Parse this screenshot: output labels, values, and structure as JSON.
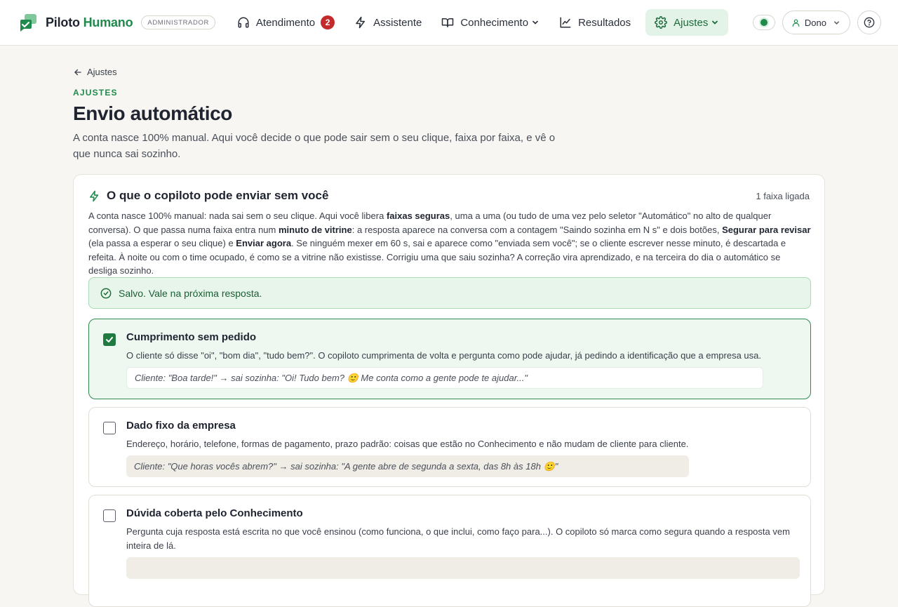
{
  "brand": {
    "name_a": "Piloto ",
    "name_b": "Humano",
    "role": "ADMINISTRADOR",
    "accent_color": "#1f8a4c"
  },
  "nav": {
    "items": [
      {
        "label": "Atendimento",
        "icon": "headset-icon",
        "badge": "2"
      },
      {
        "label": "Assistente",
        "icon": "lightning-icon"
      },
      {
        "label": "Conhecimento",
        "icon": "book-icon"
      },
      {
        "label": "Resultados",
        "icon": "chart-line-icon"
      },
      {
        "label": "Ajustes",
        "icon": "gear-icon",
        "active": true
      }
    ]
  },
  "user": {
    "label": "Dono"
  },
  "page": {
    "back_label": "Ajustes",
    "eyebrow": "AJUSTES",
    "title": "Envio automático",
    "description": "A conta nasce 100% manual. Aqui você decide o que pode sair sem o seu clique, faixa por faixa, e vê o que nunca sai sozinho."
  },
  "card": {
    "title": "O que o copiloto pode enviar sem você",
    "count": "1 faixa ligada",
    "intro": {
      "p1": "A conta nasce 100% manual: nada sai sem o seu clique. Aqui você libera ",
      "b1": "faixas seguras",
      "p2": ", uma a uma (ou tudo de uma vez pelo seletor \"Automático\" no alto de qualquer conversa). O que passa numa faixa entra num ",
      "b2": "minuto de vitrine",
      "p3": ": a resposta aparece na conversa com a contagem \"Saindo sozinha em N s\" e dois botões, ",
      "b3": "Segurar para revisar",
      "p4": " (ela passa a esperar o seu clique) e ",
      "b4": "Enviar agora",
      "p5": ". Se ninguém mexer em 60 s, sai e aparece como \"enviada sem você\"; se o cliente escrever nesse minuto, é descartada e refeita. À noite ou com o time ocupado, é como se a vitrine não existisse. Corrigiu uma que saiu sozinha? A correção vira aprendizado, e na terceira do dia o automático se desliga sozinho."
    },
    "alert": "Salvo. Vale na próxima resposta.",
    "lanes": [
      {
        "title": "Cumprimento sem pedido",
        "checked": true,
        "description": "O cliente só disse \"oi\", \"bom dia\", \"tudo bem?\". O copiloto cumprimenta de volta e pergunta como pode ajudar, já pedindo a identificação que a empresa usa.",
        "example": "Cliente: \"Boa tarde!\" → sai sozinha: \"Oi! Tudo bem? 🙂 Me conta como a gente pode te ajudar...\""
      },
      {
        "title": "Dado fixo da empresa",
        "checked": false,
        "description": "Endereço, horário, telefone, formas de pagamento, prazo padrão: coisas que estão no Conhecimento e não mudam de cliente para cliente.",
        "example": "Cliente: \"Que horas vocês abrem?\" → sai sozinha: \"A gente abre de segunda a sexta, das 8h às 18h 🙂\""
      },
      {
        "title": "Dúvida coberta pelo Conhecimento",
        "checked": false,
        "description": "Pergunta cuja resposta está escrita no que você ensinou (como funciona, o que inclui, como faço para...). O copiloto só marca como segura quando a resposta vem inteira de lá.",
        "example": ""
      }
    ]
  }
}
